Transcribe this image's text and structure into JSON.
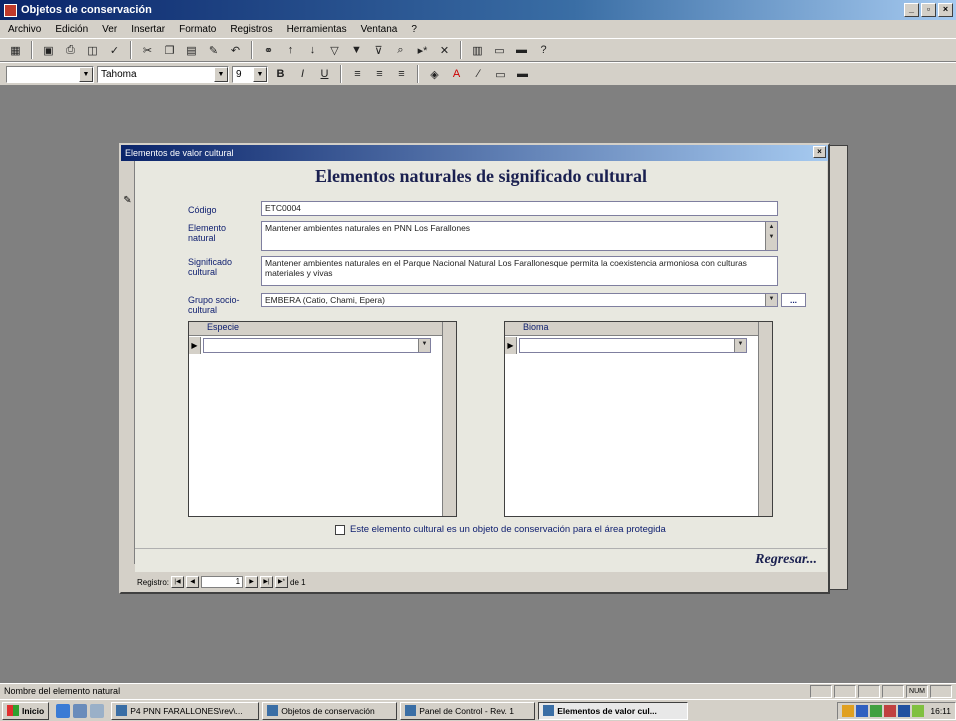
{
  "window": {
    "title": "Objetos de conservación"
  },
  "menu": [
    "Archivo",
    "Edición",
    "Ver",
    "Insertar",
    "Formato",
    "Registros",
    "Herramientas",
    "Ventana",
    "?"
  ],
  "format_toolbar": {
    "object_combo": "",
    "font": "Tahoma",
    "size": "9"
  },
  "form": {
    "window_title": "Elementos de valor cultural",
    "heading": "Elementos naturales de significado cultural",
    "fields": {
      "codigo": {
        "label": "Código",
        "value": "ETC0004"
      },
      "elemento": {
        "label": "Elemento natural",
        "value": "Mantener ambientes naturales en PNN Los Farallones"
      },
      "significado": {
        "label": "Significado cultural",
        "value": "Mantener ambientes naturales en el Parque Nacional Natural Los Farallonesque permita la coexistencia armoniosa con culturas materiales y vivas"
      },
      "grupo": {
        "label": "Grupo socio-cultural",
        "value": "EMBERA (Catio, Chami, Epera)",
        "button": "..."
      }
    },
    "subforms": {
      "especie": "Especie",
      "bioma": "Bioma"
    },
    "checkbox_label": "Este elemento cultural es un objeto de conservación para el área protegida",
    "regresar": "Regresar...",
    "nav": {
      "label": "Registro:",
      "current": "1",
      "of_text": "de 1"
    }
  },
  "statusbar": {
    "text": "Nombre del elemento natural",
    "indicator": "NUM"
  },
  "taskbar": {
    "start": "Inicio",
    "items": [
      {
        "label": "P4 PNN FARALLONES\\rev\\...",
        "active": false
      },
      {
        "label": "Objetos de conservación",
        "active": false
      },
      {
        "label": "Panel de Control - Rev. 1",
        "active": false
      },
      {
        "label": "Elementos de valor cul...",
        "active": true
      }
    ],
    "clock": "16:11"
  }
}
